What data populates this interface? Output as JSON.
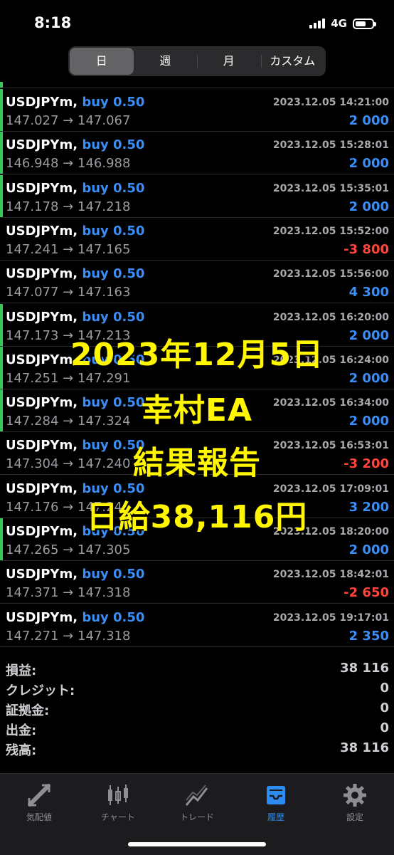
{
  "status": {
    "time": "8:18",
    "network": "4G"
  },
  "period_tabs": [
    {
      "label": "日",
      "active": true
    },
    {
      "label": "週",
      "active": false
    },
    {
      "label": "月",
      "active": false
    },
    {
      "label": "カスタム",
      "active": false
    }
  ],
  "trades": [
    {
      "symbol": "USDJPYm,",
      "side": "buy 0.50",
      "datetime": "2023.12.05 14:21:00",
      "open": "147.027",
      "close": "147.067",
      "profit": "2 000",
      "positive": true,
      "bar": true
    },
    {
      "symbol": "USDJPYm,",
      "side": "buy 0.50",
      "datetime": "2023.12.05 15:28:01",
      "open": "146.948",
      "close": "146.988",
      "profit": "2 000",
      "positive": true,
      "bar": true
    },
    {
      "symbol": "USDJPYm,",
      "side": "buy 0.50",
      "datetime": "2023.12.05 15:35:01",
      "open": "147.178",
      "close": "147.218",
      "profit": "2 000",
      "positive": true,
      "bar": true
    },
    {
      "symbol": "USDJPYm,",
      "side": "buy 0.50",
      "datetime": "2023.12.05 15:52:00",
      "open": "147.241",
      "close": "147.165",
      "profit": "-3 800",
      "positive": false,
      "bar": false
    },
    {
      "symbol": "USDJPYm,",
      "side": "buy 0.50",
      "datetime": "2023.12.05 15:56:00",
      "open": "147.077",
      "close": "147.163",
      "profit": "4 300",
      "positive": true,
      "bar": false
    },
    {
      "symbol": "USDJPYm,",
      "side": "buy 0.50",
      "datetime": "2023.12.05 16:20:00",
      "open": "147.173",
      "close": "147.213",
      "profit": "2 000",
      "positive": true,
      "bar": true
    },
    {
      "symbol": "USDJPYm,",
      "side": "buy 0.50",
      "datetime": "2023.12.05 16:24:00",
      "open": "147.251",
      "close": "147.291",
      "profit": "2 000",
      "positive": true,
      "bar": true
    },
    {
      "symbol": "USDJPYm,",
      "side": "buy 0.50",
      "datetime": "2023.12.05 16:34:00",
      "open": "147.284",
      "close": "147.324",
      "profit": "2 000",
      "positive": true,
      "bar": true
    },
    {
      "symbol": "USDJPYm,",
      "side": "buy 0.50",
      "datetime": "2023.12.05 16:53:01",
      "open": "147.304",
      "close": "147.240",
      "profit": "-3 200",
      "positive": false,
      "bar": false
    },
    {
      "symbol": "USDJPYm,",
      "side": "buy 0.50",
      "datetime": "2023.12.05 17:09:01",
      "open": "147.176",
      "close": "147.240",
      "profit": "3 200",
      "positive": true,
      "bar": false
    },
    {
      "symbol": "USDJPYm,",
      "side": "buy 0.50",
      "datetime": "2023.12.05 18:20:00",
      "open": "147.265",
      "close": "147.305",
      "profit": "2 000",
      "positive": true,
      "bar": true
    },
    {
      "symbol": "USDJPYm,",
      "side": "buy 0.50",
      "datetime": "2023.12.05 18:42:01",
      "open": "147.371",
      "close": "147.318",
      "profit": "-2 650",
      "positive": false,
      "bar": false
    },
    {
      "symbol": "USDJPYm,",
      "side": "buy 0.50",
      "datetime": "2023.12.05 19:17:01",
      "open": "147.271",
      "close": "147.318",
      "profit": "2 350",
      "positive": true,
      "bar": false
    }
  ],
  "arrow": "→",
  "summary": [
    {
      "label": "損益:",
      "value": "38 116"
    },
    {
      "label": "クレジット:",
      "value": "0"
    },
    {
      "label": "証拠金:",
      "value": "0"
    },
    {
      "label": "出金:",
      "value": "0"
    },
    {
      "label": "残高:",
      "value": "38 116"
    }
  ],
  "overlay": {
    "line1": "2023年12月5日",
    "line2": "幸村EA",
    "line3": "結果報告",
    "line4": "日給38,116円"
  },
  "tabs": [
    {
      "label": "気配値",
      "icon": "quotes-icon",
      "active": false
    },
    {
      "label": "チャート",
      "icon": "chart-icon",
      "active": false
    },
    {
      "label": "トレード",
      "icon": "trade-icon",
      "active": false
    },
    {
      "label": "履歴",
      "icon": "history-icon",
      "active": true
    },
    {
      "label": "設定",
      "icon": "settings-icon",
      "active": false
    }
  ],
  "colors": {
    "accent": "#3a8ef6",
    "loss": "#ff453a",
    "bar": "#34c759",
    "overlay": "#fff600"
  }
}
